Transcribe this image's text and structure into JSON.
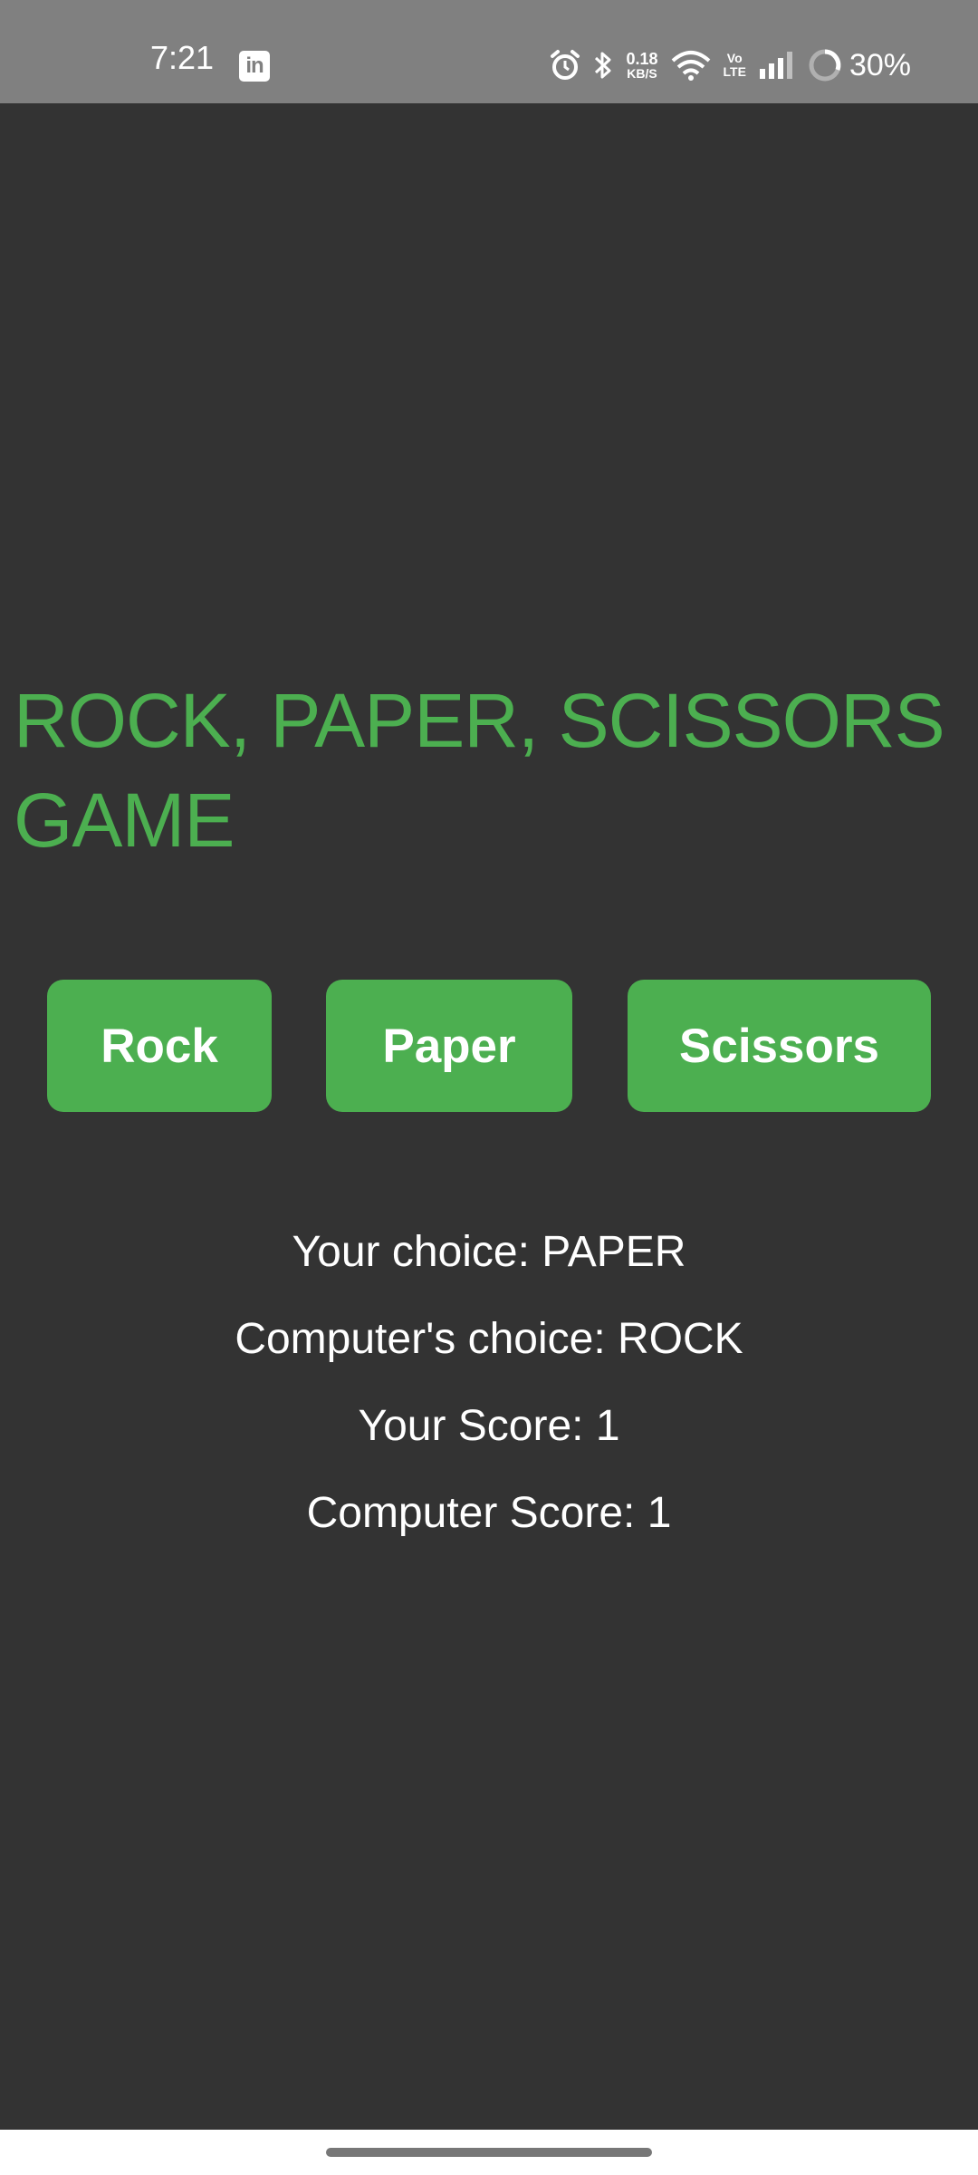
{
  "status_bar": {
    "time": "7:21",
    "app_notification_icon": "linkedin-icon",
    "app_notification_label": "in",
    "icons": [
      "alarm-icon",
      "bluetooth-icon",
      "wifi-icon",
      "signal-icon",
      "battery-ring-icon"
    ],
    "net_speed_value": "0.18",
    "net_speed_unit": "KB/S",
    "volte_top": "Vo",
    "volte_bottom": "LTE",
    "battery": "30%",
    "background_color": "#808080"
  },
  "game": {
    "title": "ROCK, PAPER, SCISSORS GAME",
    "buttons": {
      "rock": "Rock",
      "paper": "Paper",
      "scissors": "Scissors"
    },
    "results": {
      "your_choice": "Your choice: PAPER",
      "computer_choice": "Computer's choice: ROCK",
      "your_score": "Your Score: 1",
      "computer_score": "Computer Score: 1"
    }
  },
  "colors": {
    "accent": "#4caf50",
    "background": "#333333",
    "text": "#ffffff"
  }
}
